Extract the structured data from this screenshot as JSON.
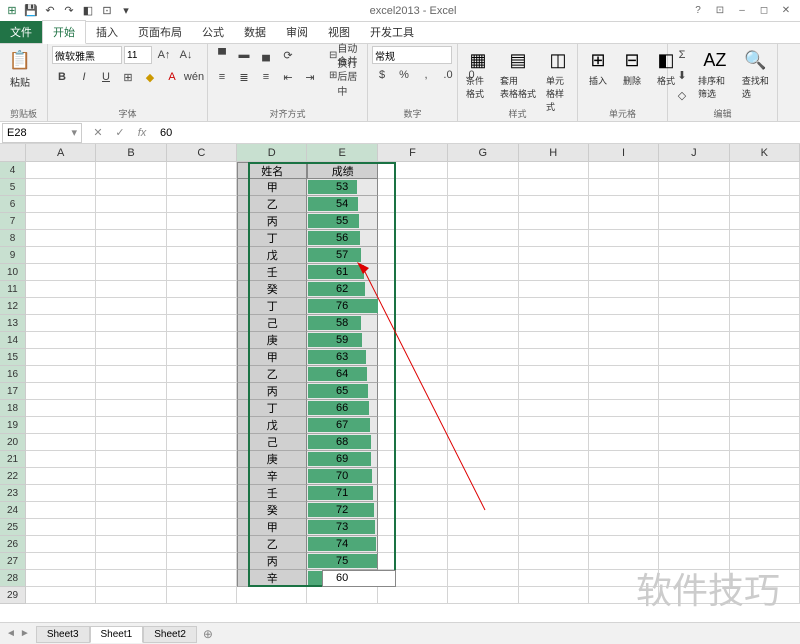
{
  "title": "excel2013 - Excel",
  "tabs": {
    "file": "文件",
    "home": "开始",
    "insert": "插入",
    "layout": "页面布局",
    "formulas": "公式",
    "data": "数据",
    "review": "审阅",
    "view": "视图",
    "dev": "开发工具"
  },
  "ribbon": {
    "clipboard": {
      "paste": "粘贴",
      "label": "剪贴板"
    },
    "font": {
      "family": "微软雅黑",
      "size": "11",
      "label": "字体"
    },
    "align": {
      "wrap": "自动换行",
      "merge": "合并后居中",
      "label": "对齐方式"
    },
    "number": {
      "format": "常规",
      "label": "数字"
    },
    "styles": {
      "cond": "条件格式",
      "table": "套用\n表格格式",
      "cell": "单元格样式",
      "label": "样式"
    },
    "cells": {
      "insert": "插入",
      "delete": "删除",
      "format": "格式",
      "label": "单元格"
    },
    "editing": {
      "sort": "排序和筛选",
      "find": "查找和选",
      "label": "编辑"
    }
  },
  "formula_bar": {
    "name_box": "E28",
    "formula": "60"
  },
  "columns": [
    "A",
    "B",
    "C",
    "D",
    "E",
    "F",
    "G",
    "H",
    "I",
    "J",
    "K"
  ],
  "rows_start": 4,
  "rows_end": 29,
  "data_header": {
    "name": "姓名",
    "score": "成绩"
  },
  "data_rows": [
    {
      "name": "甲",
      "score": 53
    },
    {
      "name": "乙",
      "score": 54
    },
    {
      "name": "丙",
      "score": 55
    },
    {
      "name": "丁",
      "score": 56
    },
    {
      "name": "戊",
      "score": 57
    },
    {
      "name": "壬",
      "score": 61
    },
    {
      "name": "癸",
      "score": 62
    },
    {
      "name": "丁",
      "score": 76
    },
    {
      "name": "己",
      "score": 58
    },
    {
      "name": "庚",
      "score": 59
    },
    {
      "name": "甲",
      "score": 63
    },
    {
      "name": "乙",
      "score": 64
    },
    {
      "name": "丙",
      "score": 65
    },
    {
      "name": "丁",
      "score": 66
    },
    {
      "name": "戊",
      "score": 67
    },
    {
      "name": "己",
      "score": 68
    },
    {
      "name": "庚",
      "score": 69
    },
    {
      "name": "辛",
      "score": 70
    },
    {
      "name": "壬",
      "score": 71
    },
    {
      "name": "癸",
      "score": 72
    },
    {
      "name": "甲",
      "score": 73
    },
    {
      "name": "乙",
      "score": 74
    },
    {
      "name": "丙",
      "score": 75
    },
    {
      "name": "辛",
      "score": 60
    }
  ],
  "data_max": 76,
  "sheets": [
    "Sheet3",
    "Sheet1",
    "Sheet2"
  ],
  "active_sheet": "Sheet1",
  "watermark": "软件技巧"
}
